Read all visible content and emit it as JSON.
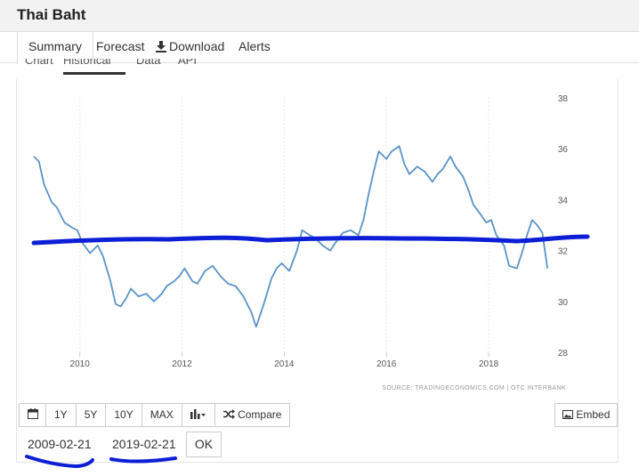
{
  "header": {
    "title": "Thai Baht"
  },
  "tabs": [
    {
      "label": "Summary",
      "active": true
    },
    {
      "label": "Forecast",
      "active": false
    },
    {
      "label": "Download",
      "active": false,
      "icon": "download-icon"
    },
    {
      "label": "Alerts",
      "active": false
    }
  ],
  "subtabs": [
    {
      "label": "Chart",
      "active": false
    },
    {
      "label": "Historical",
      "active": true
    },
    {
      "label": "Data",
      "active": false
    },
    {
      "label": "API",
      "active": false
    }
  ],
  "chart_data": {
    "type": "line",
    "title": "",
    "xlabel": "",
    "ylabel": "",
    "xlim": [
      2009.1,
      2019.2
    ],
    "ylim": [
      28,
      38
    ],
    "x_ticks": [
      "2010",
      "2012",
      "2014",
      "2016",
      "2018"
    ],
    "y_ticks": [
      "28",
      "30",
      "32",
      "34",
      "36",
      "38"
    ],
    "grid": "vertical",
    "y_axis_position": "right",
    "source": "SOURCE: TRADINGECONOMICS.COM | OTC INTERBANK",
    "color": "#5b93c6",
    "series": [
      {
        "x": [
          2009.1,
          2009.2,
          2009.3,
          2009.45,
          2009.55,
          2009.7,
          2009.85,
          2009.95,
          2010.05,
          2010.2,
          2010.35,
          2010.45,
          2010.6,
          2010.7,
          2010.8,
          2010.9,
          2011.0,
          2011.15,
          2011.3,
          2011.45,
          2011.6,
          2011.7,
          2011.85,
          2011.95,
          2012.05,
          2012.2,
          2012.3,
          2012.45,
          2012.6,
          2012.75,
          2012.9,
          2013.05,
          2013.2,
          2013.35,
          2013.45,
          2013.6,
          2013.75,
          2013.85,
          2013.95,
          2014.1,
          2014.25,
          2014.35,
          2014.5,
          2014.6,
          2014.75,
          2014.9,
          2015.0,
          2015.15,
          2015.3,
          2015.45,
          2015.55,
          2015.65,
          2015.75,
          2015.85,
          2016.0,
          2016.1,
          2016.25,
          2016.35,
          2016.45,
          2016.6,
          2016.75,
          2016.9,
          2017.0,
          2017.1,
          2017.25,
          2017.35,
          2017.5,
          2017.6,
          2017.7,
          2017.85,
          2017.95,
          2018.05,
          2018.15,
          2018.3,
          2018.4,
          2018.55,
          2018.65,
          2018.75,
          2018.85,
          2018.95,
          2019.05,
          2019.15
        ],
        "y": [
          35.7,
          35.5,
          34.6,
          33.9,
          33.7,
          33.1,
          32.9,
          32.8,
          32.3,
          31.9,
          32.2,
          31.8,
          30.8,
          29.9,
          29.8,
          30.1,
          30.5,
          30.2,
          30.3,
          30.0,
          30.3,
          30.6,
          30.8,
          31.0,
          31.3,
          30.8,
          30.7,
          31.2,
          31.4,
          31.0,
          30.7,
          30.6,
          30.2,
          29.6,
          29.0,
          29.9,
          30.9,
          31.3,
          31.5,
          31.2,
          32.0,
          32.8,
          32.6,
          32.5,
          32.2,
          32.0,
          32.3,
          32.7,
          32.8,
          32.6,
          33.2,
          34.2,
          35.1,
          35.9,
          35.6,
          35.9,
          36.1,
          35.4,
          35.0,
          35.3,
          35.1,
          34.7,
          35.0,
          35.2,
          35.7,
          35.3,
          34.9,
          34.4,
          33.8,
          33.4,
          33.1,
          33.2,
          32.6,
          32.2,
          31.4,
          31.3,
          31.9,
          32.6,
          33.2,
          33.0,
          32.7,
          31.3
        ]
      }
    ]
  },
  "toolbar": {
    "buttons": [
      "1Y",
      "5Y",
      "10Y",
      "MAX",
      "Compare"
    ],
    "embed": "Embed"
  },
  "dates": {
    "start": "2009-02-21",
    "end": "2019-02-21",
    "ok": "OK"
  },
  "colors": {
    "line": "#5b93c6",
    "ink": "#0d1fd6",
    "grid": "#e6e6e6"
  }
}
